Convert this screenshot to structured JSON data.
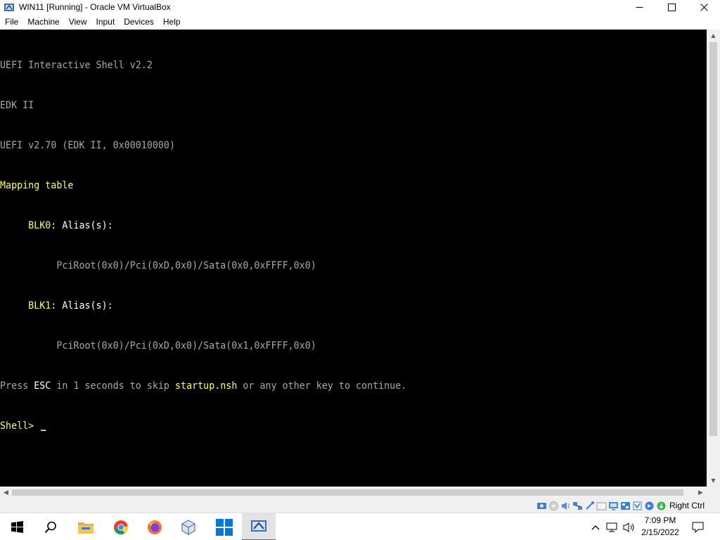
{
  "window": {
    "title": "WIN11 [Running] - Oracle VM VirtualBox",
    "minimize_icon": "minimize-icon",
    "maximize_icon": "maximize-icon",
    "close_icon": "close-icon"
  },
  "menubar": {
    "items": [
      "File",
      "Machine",
      "View",
      "Input",
      "Devices",
      "Help"
    ]
  },
  "console": {
    "line1": "UEFI Interactive Shell v2.2",
    "line2": "EDK II",
    "line3": "UEFI v2.70 (EDK II, 0x00010000)",
    "line4": "Mapping table",
    "blk0_name": "BLK0",
    "blk0_alias": ": Alias(s):",
    "blk0_path": "PciRoot(0x0)/Pci(0xD,0x0)/Sata(0x0,0xFFFF,0x0)",
    "blk1_name": "BLK1",
    "blk1_alias": ": Alias(s):",
    "blk1_path": "PciRoot(0x0)/Pci(0xD,0x0)/Sata(0x1,0xFFFF,0x0)",
    "press_prefix": "Press ",
    "press_esc": "ESC",
    "press_mid": " in 1 seconds to skip ",
    "press_file": "startup.nsh",
    "press_suffix": " or any other key to continue.",
    "prompt": "Shell> "
  },
  "statusbar": {
    "host_key": "Right Ctrl",
    "icons": [
      "hard-disk-icon",
      "optical-drive-icon",
      "audio-icon",
      "network-icon",
      "usb-icon",
      "shared-folders-icon",
      "display-icon",
      "video-capture-icon",
      "cpu-icon",
      "mouse-integration-icon",
      "keyboard-icon"
    ]
  },
  "taskbar": {
    "apps": [
      "start-icon",
      "search-icon",
      "file-explorer-icon",
      "chrome-icon",
      "firefox-icon",
      "virtualbox-icon",
      "windows11-icon",
      "win11-vm-icon"
    ],
    "time": "7:09 PM",
    "date": "2/15/2022",
    "tray": [
      "show-hidden-icons-icon",
      "network-icon",
      "volume-icon",
      "notifications-icon"
    ]
  },
  "colors": {
    "console_bg": "#000000",
    "console_gray": "#a8a8a8",
    "console_yellow": "#ffff55",
    "console_white": "#ffffff",
    "taskbar_active": "#e3e3e3"
  }
}
